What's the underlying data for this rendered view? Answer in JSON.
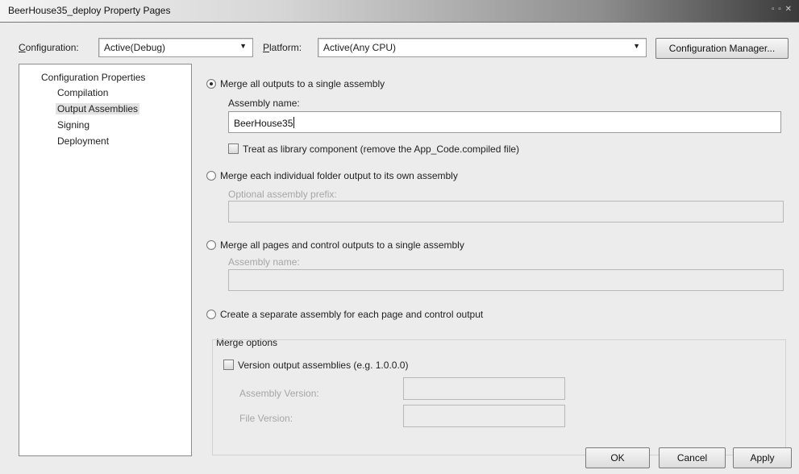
{
  "window": {
    "title": "BeerHouse35_deploy Property Pages",
    "controls": "▫ ▫ ✕"
  },
  "toolbar": {
    "configuration_label": "Configuration:",
    "configuration_value": "Active(Debug)",
    "platform_label": "Platform:",
    "platform_value": "Active(Any CPU)",
    "config_manager_button": "Configuration Manager..."
  },
  "tree": {
    "root": "Configuration Properties",
    "items": [
      {
        "label": "Compilation"
      },
      {
        "label": "Output Assemblies"
      },
      {
        "label": "Signing"
      },
      {
        "label": "Deployment"
      }
    ],
    "selected": "Output Assemblies"
  },
  "options": {
    "merge_single": {
      "label": "Merge all outputs to a single assembly",
      "selected": true,
      "name_label": "Assembly name:",
      "name_value": "BeerHouse35",
      "library_checkbox": "Treat as library component (remove the App_Code.compiled file)",
      "library_checked": false
    },
    "merge_folder": {
      "label": "Merge each individual folder output to its own assembly",
      "selected": false,
      "prefix_label": "Optional assembly prefix:",
      "prefix_value": ""
    },
    "merge_pages": {
      "label": "Merge all pages and control outputs to a single assembly",
      "selected": false,
      "name_label": "Assembly name:",
      "name_value": ""
    },
    "separate": {
      "label": "Create a separate assembly for each page and control output",
      "selected": false
    }
  },
  "merge_options": {
    "title": "Merge options",
    "version_checkbox": "Version output assemblies (e.g. 1.0.0.0)",
    "version_checked": false,
    "assembly_version_label": "Assembly Version:",
    "assembly_version_value": "",
    "file_version_label": "File Version:",
    "file_version_value": ""
  },
  "buttons": {
    "ok": "OK",
    "cancel": "Cancel",
    "apply": "Apply"
  }
}
